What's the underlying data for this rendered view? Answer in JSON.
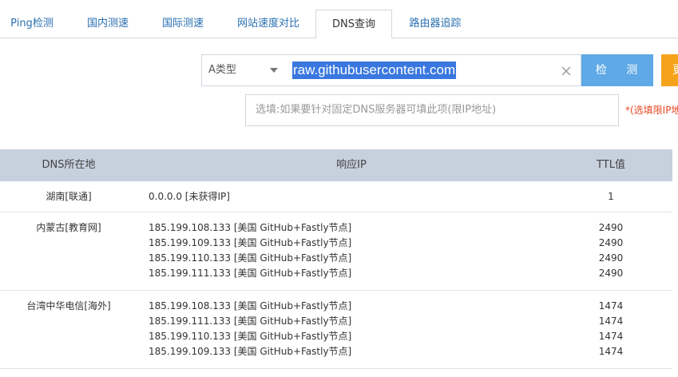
{
  "tabs": [
    {
      "label": "Ping检测",
      "active": false
    },
    {
      "label": "国内测速",
      "active": false
    },
    {
      "label": "国际测速",
      "active": false
    },
    {
      "label": "网站速度对比",
      "active": false
    },
    {
      "label": "DNS查询",
      "active": true
    },
    {
      "label": "路由器追踪",
      "active": false
    }
  ],
  "query": {
    "record_type": "A类型",
    "domain": "raw.githubusercontent.com",
    "detect_label": "检  测",
    "orange_label": "更",
    "dns_placeholder": "选填:如果要针对固定DNS服务器可填此项(限IP地址)",
    "dns_note": "*(选填限IP地址)"
  },
  "table": {
    "headers": [
      "DNS所在地",
      "响应IP",
      "TTL值"
    ],
    "rows": [
      {
        "location": "湖南[联通]",
        "ips": [
          "0.0.0.0 [未获得IP]"
        ],
        "ttls": [
          "1"
        ]
      },
      {
        "location": "内蒙古[教育网]",
        "ips": [
          "185.199.108.133 [美国 GitHub+Fastly节点]",
          "185.199.109.133 [美国 GitHub+Fastly节点]",
          "185.199.110.133 [美国 GitHub+Fastly节点]",
          "185.199.111.133 [美国 GitHub+Fastly节点]"
        ],
        "ttls": [
          "2490",
          "2490",
          "2490",
          "2490"
        ]
      },
      {
        "location": "台湾中华电信[海外]",
        "ips": [
          "185.199.108.133 [美国 GitHub+Fastly节点]",
          "185.199.111.133 [美国 GitHub+Fastly节点]",
          "185.199.110.133 [美国 GitHub+Fastly节点]",
          "185.199.109.133 [美国 GitHub+Fastly节点]"
        ],
        "ttls": [
          "1474",
          "1474",
          "1474",
          "1474"
        ]
      }
    ]
  },
  "colors": {
    "tab_link": "#2a6fb0",
    "detect_button": "#5fa9e6",
    "orange_button": "#f5a31a",
    "table_header": "#c7d0dd",
    "selection": "#3a78e0",
    "note": "#e8461f"
  }
}
